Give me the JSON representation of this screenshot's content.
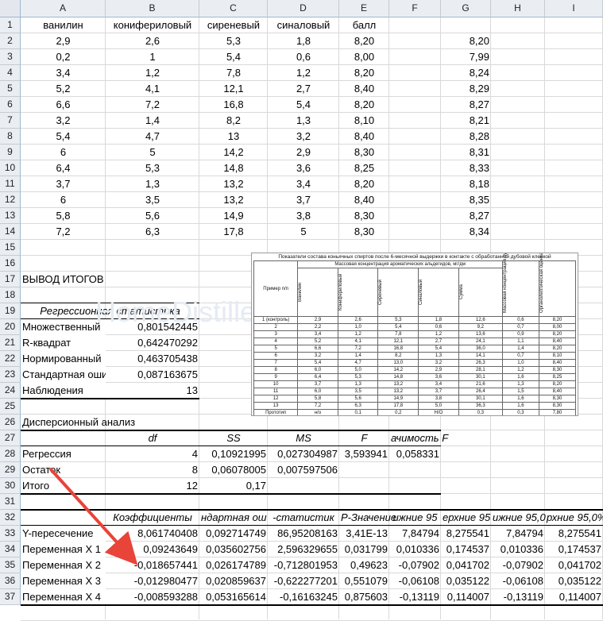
{
  "columns": [
    "A",
    "B",
    "C",
    "D",
    "E",
    "F",
    "G",
    "H",
    "I"
  ],
  "rows": [
    "1",
    "2",
    "3",
    "4",
    "5",
    "6",
    "7",
    "8",
    "9",
    "10",
    "11",
    "12",
    "13",
    "14",
    "15",
    "16",
    "17",
    "18",
    "19",
    "20",
    "21",
    "22",
    "23",
    "24",
    "25",
    "26",
    "27",
    "28",
    "29",
    "30",
    "31",
    "32",
    "33",
    "34",
    "35",
    "36",
    "37"
  ],
  "header_row": [
    "ванилин",
    "конифериловый",
    "сиреневый",
    "синаловый",
    "балл"
  ],
  "data_rows": [
    [
      "2,9",
      "2,6",
      "5,3",
      "1,8",
      "8,20",
      "8,20"
    ],
    [
      "0,2",
      "1",
      "5,4",
      "0,6",
      "8,00",
      "7,99"
    ],
    [
      "3,4",
      "1,2",
      "7,8",
      "1,2",
      "8,20",
      "8,24"
    ],
    [
      "5,2",
      "4,1",
      "12,1",
      "2,7",
      "8,40",
      "8,29"
    ],
    [
      "6,6",
      "7,2",
      "16,8",
      "5,4",
      "8,20",
      "8,27"
    ],
    [
      "3,2",
      "1,4",
      "8,2",
      "1,3",
      "8,10",
      "8,21"
    ],
    [
      "5,4",
      "4,7",
      "13",
      "3,2",
      "8,40",
      "8,28"
    ],
    [
      "6",
      "5",
      "14,2",
      "2,9",
      "8,30",
      "8,31"
    ],
    [
      "6,4",
      "5,3",
      "14,8",
      "3,6",
      "8,25",
      "8,33"
    ],
    [
      "3,7",
      "1,3",
      "13,2",
      "3,4",
      "8,20",
      "8,18"
    ],
    [
      "6",
      "3,5",
      "13,2",
      "3,7",
      "8,40",
      "8,35"
    ],
    [
      "5,8",
      "5,6",
      "14,9",
      "3,8",
      "8,30",
      "8,27"
    ],
    [
      "7,2",
      "6,3",
      "17,8",
      "5",
      "8,30",
      "8,34"
    ]
  ],
  "summary": {
    "title": "ВЫВОД ИТОГОВ",
    "reg_stats_title": "Регрессионная статистика",
    "stats": [
      [
        "Множественный",
        "0,801542445"
      ],
      [
        "R-квадрат",
        "0,642470292"
      ],
      [
        "Нормированный",
        "0,463705438"
      ],
      [
        "Стандартная оши",
        "0,087163675"
      ],
      [
        "Наблюдения",
        "13"
      ]
    ]
  },
  "anova": {
    "title": "Дисперсионный анализ",
    "headers": [
      "df",
      "SS",
      "MS",
      "F",
      "ачимость F"
    ],
    "rows": [
      [
        "Регрессия",
        "4",
        "0,10921995",
        "0,027304987",
        "3,593941",
        "0,058331"
      ],
      [
        "Остаток",
        "8",
        "0,06078005",
        "0,007597506",
        "",
        ""
      ],
      [
        "Итого",
        "12",
        "0,17",
        "",
        "",
        ""
      ]
    ]
  },
  "coef": {
    "headers": [
      "Коэффициенты",
      "ндартная ош",
      "-статистик",
      "Р-Значение",
      "ижние 95",
      "ерхние 95",
      "ижние 95,0",
      "рхние 95,0%"
    ],
    "rows": [
      [
        "Y-пересечение",
        "8,061740408",
        "0,092714749",
        "86,95208163",
        "3,41E-13",
        "7,84794",
        "8,275541",
        "7,84794",
        "8,275541"
      ],
      [
        "Переменная X 1",
        "0,09243649",
        "0,035602756",
        "2,596329655",
        "0,031799",
        "0,010336",
        "0,174537",
        "0,010336",
        "0,174537"
      ],
      [
        "Переменная X 2",
        "-0,018657441",
        "0,026174789",
        "-0,712801953",
        "0,49623",
        "-0,07902",
        "0,041702",
        "-0,07902",
        "0,041702"
      ],
      [
        "Переменная X 3",
        "-0,012980477",
        "0,020859637",
        "-0,622277201",
        "0,551079",
        "-0,06108",
        "0,035122",
        "-0,06108",
        "0,035122"
      ],
      [
        "Переменная X 4",
        "-0,008593288",
        "0,053165614",
        "-0,16163245",
        "0,875603",
        "-0,13119",
        "0,114007",
        "-0,13119",
        "0,114007"
      ]
    ]
  },
  "scan": {
    "caption": "Показатели состава коньячных спиртов после 6-месячной выдержки в контакте с обработанной дубовой клепкой",
    "col1": "Пример п/п",
    "group": "Массовая концентрация ароматических альдегидов, мг/дм",
    "vert_headers": [
      "Ванилин",
      "Конифериловый",
      "Сиреневый",
      "Синаловый",
      "Сумма",
      "Массовая концентрация дубильных веществ, г/дм",
      "Органолептическая оценка"
    ],
    "rows": [
      [
        "1 (контроль)",
        "2,9",
        "2,6",
        "5,3",
        "1,8",
        "12,6",
        "0,6",
        "8,20"
      ],
      [
        "2",
        "2,2",
        "1,0",
        "5,4",
        "0,6",
        "9,2",
        "0,7",
        "8,00"
      ],
      [
        "3",
        "3,4",
        "1,2",
        "7,8",
        "1,2",
        "13,6",
        "0,9",
        "8,20"
      ],
      [
        "4",
        "5,2",
        "4,1",
        "12,1",
        "2,7",
        "24,1",
        "1,1",
        "8,40"
      ],
      [
        "5",
        "6,6",
        "7,2",
        "16,8",
        "5,4",
        "36,0",
        "1,4",
        "8,20"
      ],
      [
        "6",
        "3,2",
        "1,4",
        "8,2",
        "1,3",
        "14,1",
        "0,7",
        "8,10"
      ],
      [
        "7",
        "5,4",
        "4,7",
        "13,0",
        "3,2",
        "26,3",
        "1,0",
        "8,40"
      ],
      [
        "8",
        "6,0",
        "5,0",
        "14,2",
        "2,9",
        "28,1",
        "1,2",
        "8,30"
      ],
      [
        "9",
        "6,4",
        "5,3",
        "14,8",
        "3,6",
        "30,1",
        "1,6",
        "8,25"
      ],
      [
        "10",
        "3,7",
        "1,3",
        "13,2",
        "3,4",
        "21,6",
        "1,3",
        "8,20"
      ],
      [
        "11",
        "6,0",
        "3,5",
        "13,2",
        "3,7",
        "26,4",
        "1,5",
        "8,40"
      ],
      [
        "12",
        "5,8",
        "5,6",
        "14,9",
        "3,8",
        "30,1",
        "1,6",
        "8,30"
      ],
      [
        "13",
        "7,2",
        "6,3",
        "17,8",
        "5,0",
        "36,3",
        "1,6",
        "8,30"
      ],
      [
        "Прототип",
        "н/о",
        "0,1",
        "0,2",
        "Н/О",
        "0,3",
        "0,3",
        "7,80"
      ]
    ]
  },
  "watermark": "HomeDistiller.ru",
  "colors": {
    "arrow": "#e8443a",
    "header_bg": "#eaeef3",
    "grid": "#d9d9d9"
  }
}
